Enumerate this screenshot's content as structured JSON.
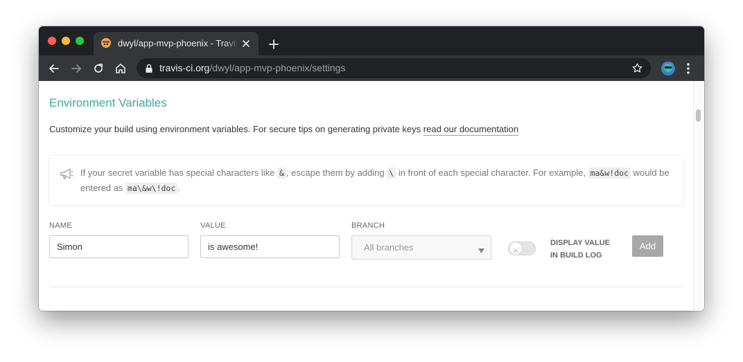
{
  "tab": {
    "title": "dwyl/app-mvp-phoenix - Travis CI",
    "favicon": "travis-mascot-icon"
  },
  "toolbar": {
    "url_host": "travis-ci.org",
    "url_path": "/dwyl/app-mvp-phoenix/settings",
    "icons": [
      "back-arrow-icon",
      "forward-arrow-icon",
      "reload-icon",
      "home-icon",
      "lock-icon",
      "star-icon",
      "profile-avatar-icon",
      "more-menu-icon"
    ]
  },
  "page": {
    "title": "Environment Variables",
    "intro_text": "Customize your build using environment variables. For secure tips on generating private keys ",
    "doc_link": "read our documentation"
  },
  "notice": {
    "text_1": "If your secret variable has special characters like ",
    "code_amp": "&",
    "text_2": ", escape them by adding ",
    "code_backslash": "\\",
    "text_3": " in front of each special character. For example, ",
    "code_example": "ma&w!doc",
    "text_4": " would be entered as ",
    "code_escaped": "ma\\&w\\!doc",
    "text_5": "."
  },
  "form": {
    "name_label": "NAME",
    "name_value": "Simon",
    "value_label": "VALUE",
    "value_value": "is awesome!",
    "branch_label": "BRANCH",
    "branch_selected": "All branches",
    "display_label_line1": "DISPLAY VALUE",
    "display_label_line2": "IN BUILD LOG",
    "display_toggle_on": false,
    "add_label": "Add"
  },
  "colors": {
    "accent": "#39a9a0",
    "button_disabled": "#a8a8a8",
    "tab_bar": "#202124",
    "toolbar": "#35363a"
  }
}
